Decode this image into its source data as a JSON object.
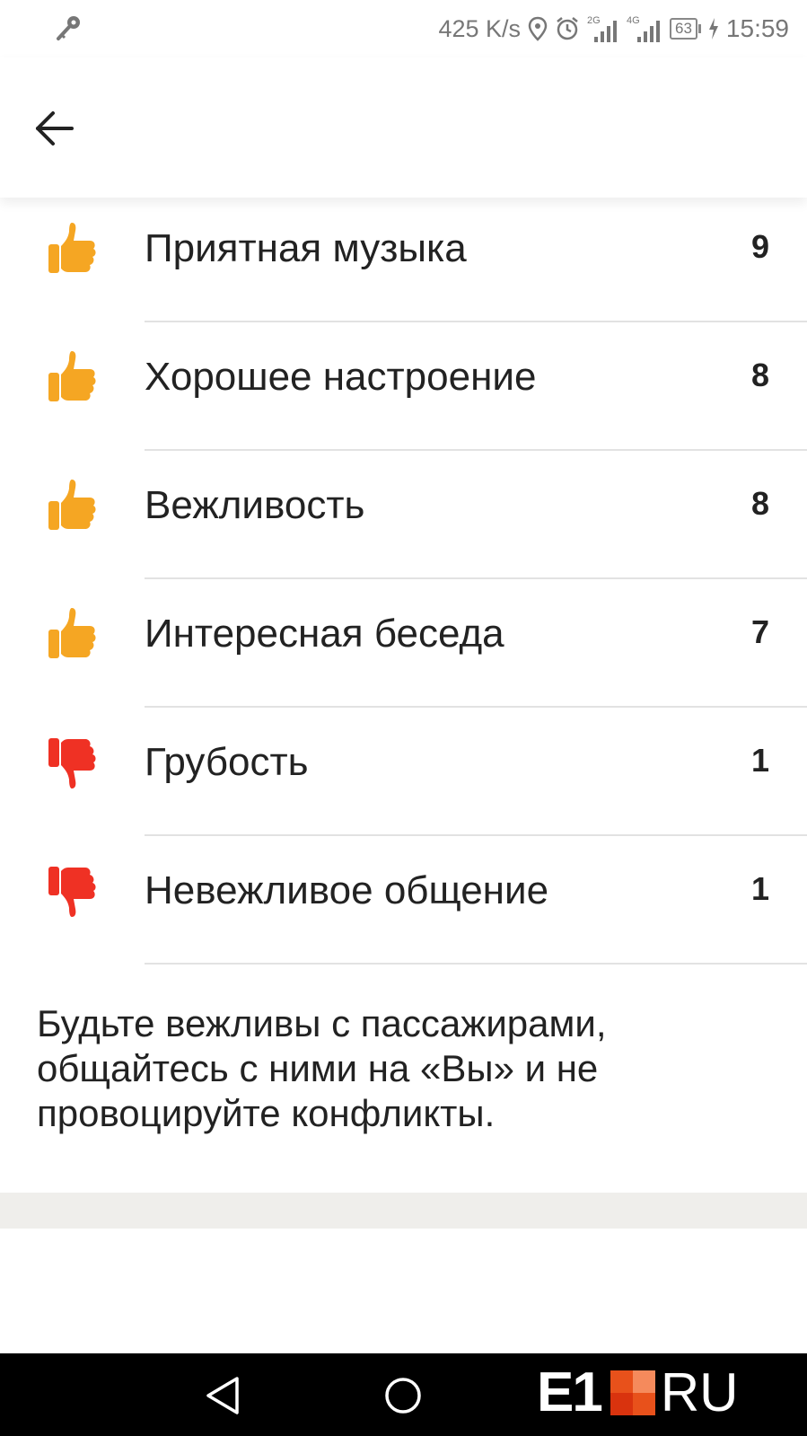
{
  "status_bar": {
    "speed": "425 K/s",
    "network_1": "2G",
    "network_2": "4G",
    "battery": "63",
    "time": "15:59"
  },
  "toolbar": {
    "back_icon": "arrow-left-icon"
  },
  "items": [
    {
      "label": "Приятная музыка",
      "count": "9",
      "sentiment": "positive"
    },
    {
      "label": "Хорошее настроение",
      "count": "8",
      "sentiment": "positive"
    },
    {
      "label": "Вежливость",
      "count": "8",
      "sentiment": "positive"
    },
    {
      "label": "Интересная беседа",
      "count": "7",
      "sentiment": "positive"
    },
    {
      "label": "Грубость",
      "count": "1",
      "sentiment": "negative"
    },
    {
      "label": "Невежливое общение",
      "count": "1",
      "sentiment": "negative"
    }
  ],
  "hint": "Будьте вежливы с пассажирами, общайтесь с ними на «Вы» и не провоцируйте конфликты.",
  "watermark": {
    "left": "E1",
    "right": "RU"
  },
  "colors": {
    "thumb_up": "#f5a623",
    "thumb_down": "#ef3124",
    "divider": "#e2e2e2",
    "band": "#efeeeb"
  }
}
